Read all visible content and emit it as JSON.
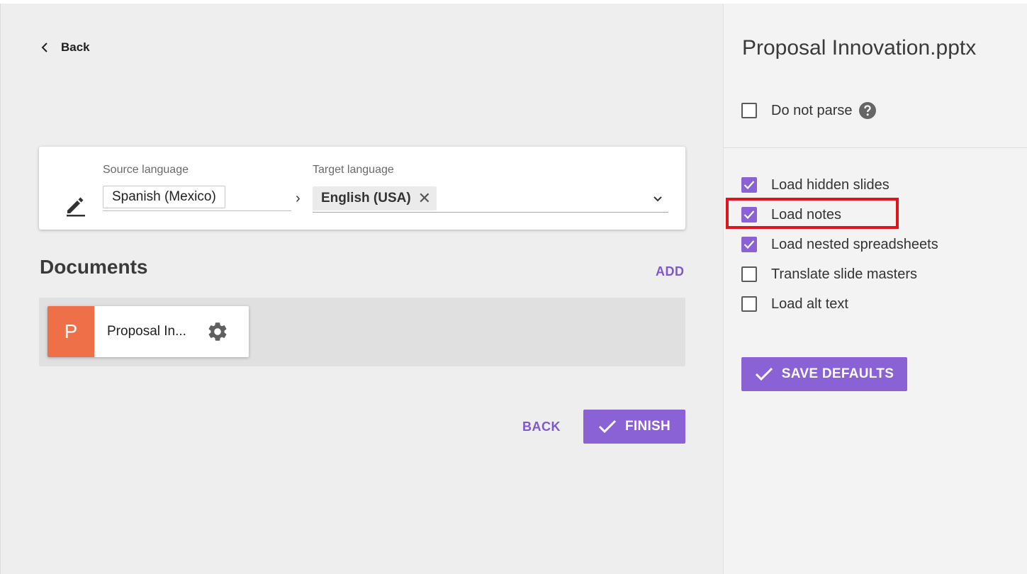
{
  "nav": {
    "back_label": "Back"
  },
  "languages": {
    "source_label": "Source language",
    "source_value": "Spanish (Mexico)",
    "separator": "›",
    "target_label": "Target language",
    "target_value": "English (USA)",
    "remove_glyph": "✕"
  },
  "documents": {
    "title": "Documents",
    "add_label": "ADD",
    "items": [
      {
        "badge": "P",
        "name": "Proposal In...",
        "badge_color": "#ee7048"
      }
    ]
  },
  "actions": {
    "back_label": "BACK",
    "finish_label": "FINISH"
  },
  "settings": {
    "title": "Proposal Innovation.pptx",
    "do_not_parse": {
      "label": "Do not parse",
      "checked": false
    },
    "options": [
      {
        "label": "Load hidden slides",
        "checked": true
      },
      {
        "label": "Load notes",
        "checked": true
      },
      {
        "label": "Load nested spreadsheets",
        "checked": true
      },
      {
        "label": "Translate slide masters",
        "checked": false
      },
      {
        "label": "Load alt text",
        "checked": false
      }
    ],
    "save_label": "SAVE DEFAULTS"
  },
  "colors": {
    "accent": "#8b61d6",
    "link": "#7f57d0",
    "highlight": "#e0141d"
  }
}
